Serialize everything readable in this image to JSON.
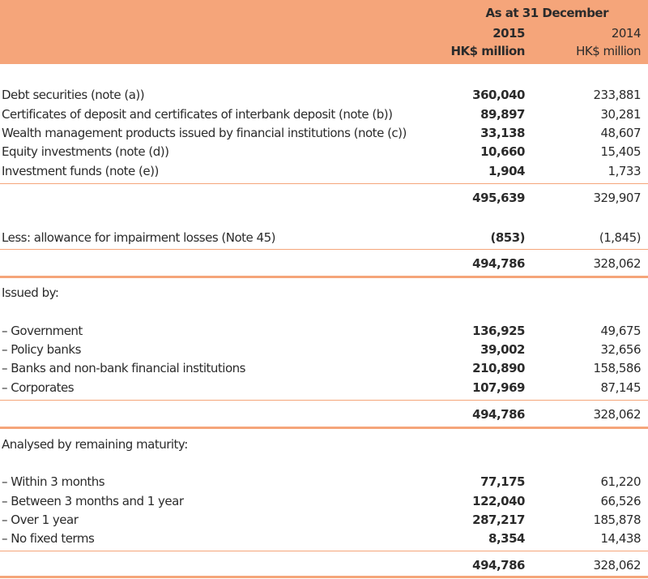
{
  "header": {
    "period": "As at 31 December",
    "year_current": "2015",
    "year_prior": "2014",
    "unit_current": "HK$ million",
    "unit_prior": "HK$ million"
  },
  "investments": [
    {
      "label": "Debt securities (note (a))",
      "v2015": "360,040",
      "v2014": "233,881"
    },
    {
      "label": "Certificates of deposit and certificates of interbank deposit (note (b))",
      "v2015": "89,897",
      "v2014": "30,281"
    },
    {
      "label": "Wealth management products issued by financial institutions (note (c))",
      "v2015": "33,138",
      "v2014": "48,607"
    },
    {
      "label": "Equity investments (note (d))",
      "v2015": "10,660",
      "v2014": "15,405"
    },
    {
      "label": "Investment funds (note (e))",
      "v2015": "1,904",
      "v2014": "1,733"
    }
  ],
  "subtotal": {
    "v2015": "495,639",
    "v2014": "329,907"
  },
  "allowance": {
    "label": "Less: allowance for impairment losses (Note 45)",
    "v2015": "(853)",
    "v2014": "(1,845)"
  },
  "net_total": {
    "v2015": "494,786",
    "v2014": "328,062"
  },
  "issued_by": {
    "heading": "Issued by:",
    "rows": [
      {
        "label": "– Government",
        "v2015": "136,925",
        "v2014": "49,675"
      },
      {
        "label": "– Policy banks",
        "v2015": "39,002",
        "v2014": "32,656"
      },
      {
        "label": "– Banks and non-bank financial institutions",
        "v2015": "210,890",
        "v2014": "158,586"
      },
      {
        "label": "– Corporates",
        "v2015": "107,969",
        "v2014": "87,145"
      }
    ],
    "total": {
      "v2015": "494,786",
      "v2014": "328,062"
    }
  },
  "maturity": {
    "heading": "Analysed by remaining maturity:",
    "rows": [
      {
        "label": "– Within 3 months",
        "v2015": "77,175",
        "v2014": "61,220"
      },
      {
        "label": "– Between 3 months and 1 year",
        "v2015": "122,040",
        "v2014": "66,526"
      },
      {
        "label": "– Over 1 year",
        "v2015": "287,217",
        "v2014": "185,878"
      },
      {
        "label": "– No fixed terms",
        "v2015": "8,354",
        "v2014": "14,438"
      }
    ],
    "total": {
      "v2015": "494,786",
      "v2014": "328,062"
    }
  },
  "colors": {
    "accent": "#f5a57a",
    "text": "#2b2b2b"
  }
}
